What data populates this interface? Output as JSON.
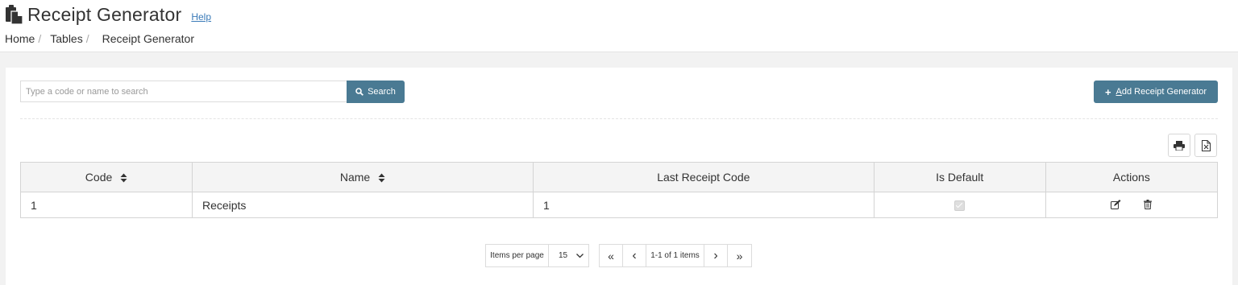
{
  "header": {
    "title": "Receipt Generator",
    "help_label": "Help",
    "breadcrumb": [
      "Home",
      "Tables",
      "Receipt Generator"
    ],
    "breadcrumb_separator": "/"
  },
  "toolbar": {
    "search_placeholder": "Type a code or name to search",
    "search_label": "Search",
    "add_label_prefix": "A",
    "add_label_rest": "dd Receipt Generator"
  },
  "table": {
    "columns": [
      "Code",
      "Name",
      "Last Receipt Code",
      "Is Default",
      "Actions"
    ],
    "rows": [
      {
        "code": "1",
        "name": "Receipts",
        "last_receipt_code": "1",
        "is_default": true
      }
    ]
  },
  "pager": {
    "items_per_page_label": "Items per page",
    "page_size": "15",
    "first": "«",
    "prev": "‹",
    "range_text": "1-1 of 1 items",
    "next": "›",
    "last": "»"
  },
  "colors": {
    "accent": "#4a7a93",
    "link": "#3a7ab8"
  }
}
